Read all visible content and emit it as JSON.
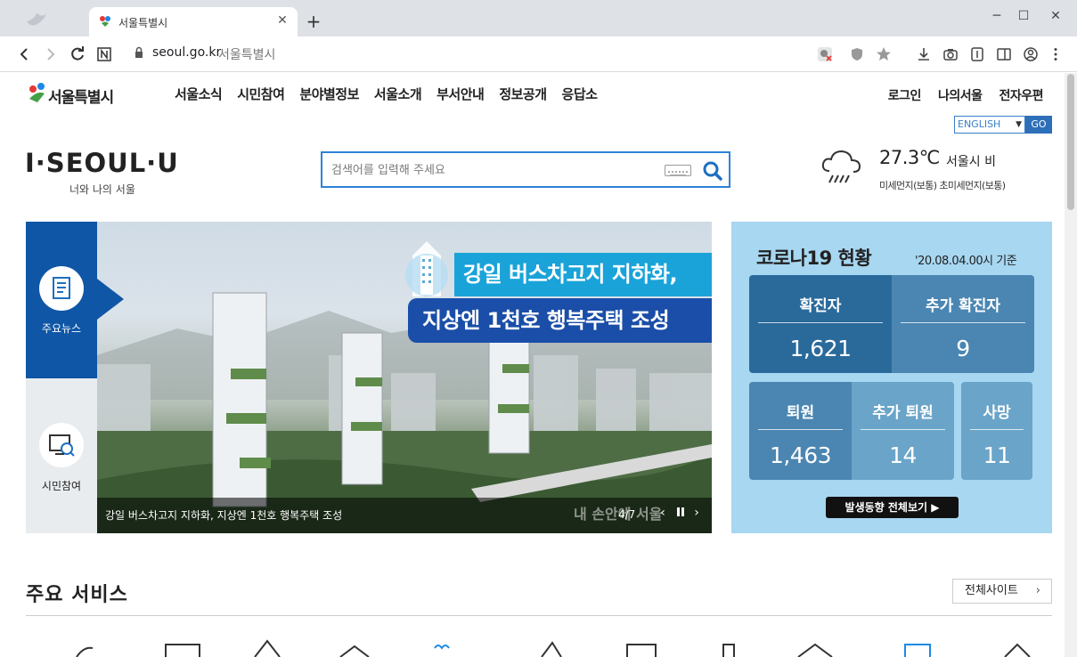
{
  "browser": {
    "tab_title": "서울특별시",
    "tab_close": "✕",
    "new_tab": "+",
    "url_domain": "seoul.go.kr",
    "url_title": "서울특별시",
    "window_minimize": "─",
    "window_maximize": "☐",
    "window_close": "✕"
  },
  "header": {
    "logo_text": "서울특별시",
    "nav": [
      "서울소식",
      "시민참여",
      "분야별정보",
      "서울소개",
      "부서안내",
      "정보공개",
      "응답소"
    ],
    "util": [
      "로그인",
      "나의서울",
      "전자우편"
    ],
    "lang_selected": "ENGLISH",
    "lang_go": "GO",
    "brand": "I·SEOUL·U",
    "brand_sub": "너와 나의 서울"
  },
  "search": {
    "placeholder": "검색어를 입력해 주세요"
  },
  "weather": {
    "temp": "27.3℃",
    "location": "서울시 비",
    "dust": "미세먼지(보통) 초미세먼지(보통)"
  },
  "side_tabs": [
    {
      "label": "주요뉴스"
    },
    {
      "label": "시민참여"
    }
  ],
  "hero": {
    "caption_line1": "강일 버스차고지 지하화,",
    "caption_line2": "지상엔 1천호 행복주택 조성",
    "bottom_text": "강일 버스차고지 지하화, 지상엔 1천호 행복주택 조성",
    "watermark": "내 손안에 서울",
    "page": "4/7"
  },
  "covid": {
    "title": "코로나19 현황",
    "date": "'20.08.04.00시 기준",
    "confirmed_label": "확진자",
    "confirmed": "1,621",
    "added_confirmed_label": "추가 확진자",
    "added_confirmed": "9",
    "released_label": "퇴원",
    "released": "1,463",
    "added_released_label": "추가 퇴원",
    "added_released": "14",
    "deaths_label": "사망",
    "deaths": "11",
    "button": "발생동향 전체보기 ▶"
  },
  "services": {
    "title": "주요 서비스",
    "all_sites": "전체사이트"
  },
  "colors": {
    "accent_blue": "#0f56a6",
    "search_border": "#2d82d8",
    "covid_bg": "#a7d7f1",
    "covid_dark": "#2a6a9b",
    "covid_mid": "#4b86b2",
    "covid_light": "#6aa4c9"
  }
}
